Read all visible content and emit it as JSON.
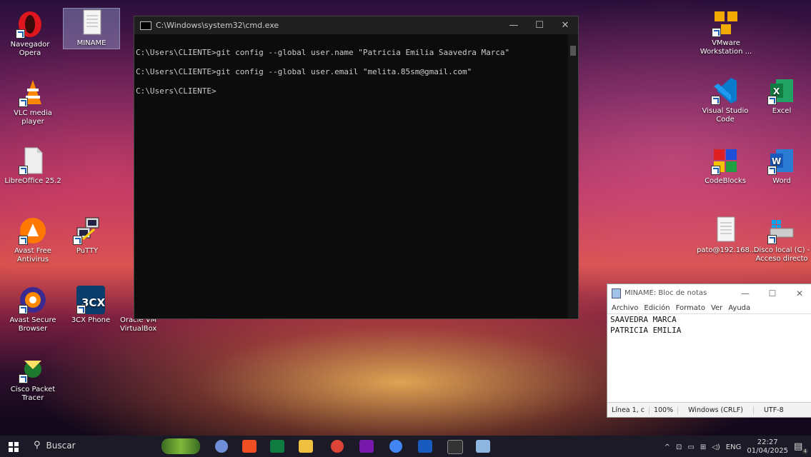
{
  "desktop": {
    "icons_left": [
      {
        "label": "Navegador Opera",
        "icon": "opera-icon"
      },
      {
        "label": "MINAME",
        "icon": "text-file-icon"
      },
      {
        "label": "VLC media player",
        "icon": "vlc-icon"
      },
      {
        "label": "LibreOffice 25.2",
        "icon": "libreoffice-icon"
      },
      {
        "label": "Avast Free Antivirus",
        "icon": "avast-icon"
      },
      {
        "label": "PuTTY",
        "icon": "putty-icon"
      },
      {
        "label": "Avast Secure Browser",
        "icon": "avast-browser-icon"
      },
      {
        "label": "3CX Phone",
        "icon": "3cx-icon"
      },
      {
        "label": "Oracle VM VirtualBox",
        "icon": "virtualbox-icon"
      },
      {
        "label": "Cisco Packet Tracer",
        "icon": "packet-tracer-icon"
      }
    ],
    "icons_right": [
      {
        "label": "VMware Workstation ...",
        "icon": "vmware-icon"
      },
      {
        "label": "Visual Studio Code",
        "icon": "vscode-icon"
      },
      {
        "label": "Excel",
        "icon": "excel-icon"
      },
      {
        "label": "CodeBlocks",
        "icon": "codeblocks-icon"
      },
      {
        "label": "Word",
        "icon": "word-icon"
      },
      {
        "label": "pato@192.168....",
        "icon": "text-file-icon"
      },
      {
        "label": "Disco local (C) - Acceso directo",
        "icon": "drive-icon"
      }
    ],
    "threecx_text": "3CX"
  },
  "cmd": {
    "title": "C:\\Windows\\system32\\cmd.exe",
    "lines": [
      "C:\\Users\\CLIENTE>git config --global user.name \"Patricia Emilia Saavedra Marca\"",
      "C:\\Users\\CLIENTE>git config --global user.email \"melita.85sm@gmail.com\"",
      "C:\\Users\\CLIENTE>"
    ],
    "min": "—",
    "max": "☐",
    "close": "✕"
  },
  "notepad": {
    "title": "MINAME: Bloc de notas",
    "menu": [
      "Archivo",
      "Edición",
      "Formato",
      "Ver",
      "Ayuda"
    ],
    "content_lines": [
      "SAAVEDRA MARCA",
      "PATRICIA EMILIA"
    ],
    "status": {
      "position": "Línea 1, c",
      "zoom": "100%",
      "eol": "Windows (CRLF)",
      "encoding": "UTF-8"
    },
    "min": "—",
    "max": "☐",
    "close": "✕"
  },
  "taskbar": {
    "search_placeholder": "Buscar",
    "tray_lang": "ENG",
    "time": "22:27",
    "date": "01/04/2025",
    "notification_count": "4",
    "tray_chevron": "^"
  }
}
